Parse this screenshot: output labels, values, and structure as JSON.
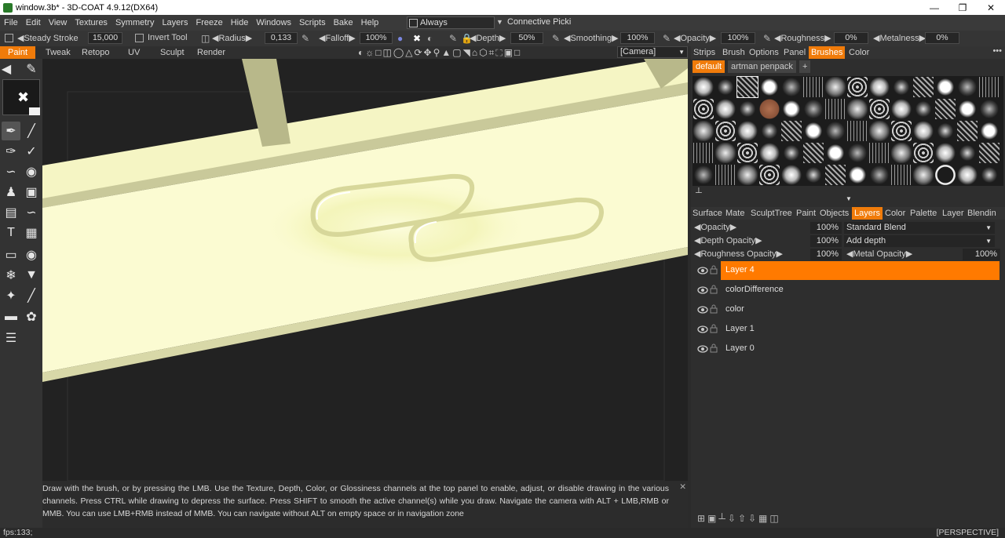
{
  "window": {
    "title": "window.3b* - 3D-COAT 4.9.12(DX64)"
  },
  "menu": {
    "items": [
      "File",
      "Edit",
      "View",
      "Textures",
      "Symmetry",
      "Layers",
      "Freeze",
      "Hide",
      "Windows",
      "Scripts",
      "Bake",
      "Help"
    ],
    "always_label": "Always",
    "connective_label": "Connective  Picki"
  },
  "options": {
    "steady_stroke": "Steady  Stroke",
    "steady_value": "15,000",
    "invert_tool": "Invert  Tool",
    "radius": "Radius",
    "radius_value": "0,133",
    "falloff": "Falloff",
    "falloff_value": "100%",
    "depth": "Depth",
    "depth_value": "50%",
    "smoothing": "Smoothing",
    "smoothing_value": "100%",
    "opacity": "Opacity",
    "opacity_value": "100%",
    "roughness": "Roughness",
    "roughness_value": "0%",
    "metalness": "Metalness",
    "metalness_value": "0%"
  },
  "rooms": {
    "tabs": [
      "Paint",
      "Tweak",
      "Retopo",
      "UV",
      "Sculpt",
      "Render"
    ],
    "active": "Paint",
    "camera": "[Camera]"
  },
  "right_panel": {
    "top_tabs": [
      "Strips",
      "Brush",
      "Options",
      "Panel",
      "Brushes",
      "Color"
    ],
    "top_active": "Brushes",
    "packs": [
      "default",
      "artman  penpack",
      "+"
    ],
    "mid_tabs": [
      "Surface",
      "Mate",
      "SculptTree",
      "Paint",
      "Objects",
      "Layers",
      "Color",
      "Palette",
      "Layer",
      "Blendin"
    ],
    "mid_active": "Layers",
    "layer_opacity_label": "Opacity",
    "layer_opacity_value": "100%",
    "blend_mode": "Standard  Blend",
    "depth_opacity_label": "Depth  Opacity",
    "depth_opacity_value": "100%",
    "depth_mode": "Add  depth",
    "roughness_opacity_label": "Roughness  Opacity",
    "roughness_opacity_value": "100%",
    "metal_opacity_label": "Metal  Opacity",
    "metal_opacity_value": "100%",
    "layers": [
      {
        "name": "Layer  4",
        "selected": true
      },
      {
        "name": "colorDifference",
        "selected": false
      },
      {
        "name": "color",
        "selected": false
      },
      {
        "name": "Layer  1",
        "selected": false
      },
      {
        "name": "Layer  0",
        "selected": false
      }
    ]
  },
  "hint": "Draw  with  the  brush,  or  by  pressing  the  LMB.  Use  the  Texture,  Depth,  Color,  or  Glossiness  channels  at  the  top  panel  to  enable,  adjust,  or  disable  drawing  in  the  various  channels.  Press  CTRL  while  drawing  to  depress  the  surface.  Press  SHIFT  to  smooth  the  active  channel(s)  while  you  draw.  Navigate  the  camera  with  ALT  +  LMB,RMB  or  MMB.  You  can  use  LMB+RMB  instead  of  MMB.  You  can  navigate  without  ALT  on  empty  space  or  in  navigation  zone",
  "status": {
    "fps": "fps:133;",
    "view": "[PERSPECTIVE]"
  },
  "colors": {
    "accent": "#f07b0a",
    "model": "#fbfbd0",
    "viewport_bg": "#222222"
  }
}
